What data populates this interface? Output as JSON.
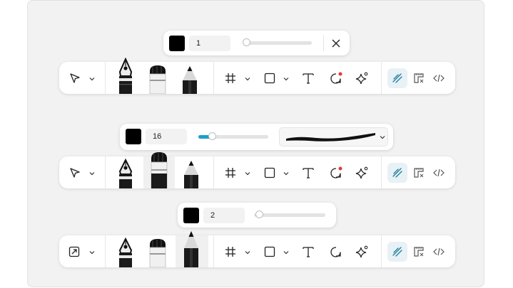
{
  "toolbars": [
    {
      "stroke_size": "1",
      "slider_fraction": 0.0,
      "select_icon": "pointer-arrow-icon",
      "has_close": true,
      "shape_dot": true
    },
    {
      "stroke_size": "16",
      "slider_fraction": 0.16,
      "select_icon": "pointer-arrow-icon",
      "brush_preview": "brush-stroke-preview",
      "shape_dot": true
    },
    {
      "stroke_size": "2",
      "slider_fraction": 0.02,
      "select_icon": "expand-to-front-icon",
      "shape_dot": false
    }
  ],
  "colors": {
    "accent": "#1fa0c7",
    "recording_dot": "#e53935",
    "active_bg": "#e8f1f5"
  }
}
